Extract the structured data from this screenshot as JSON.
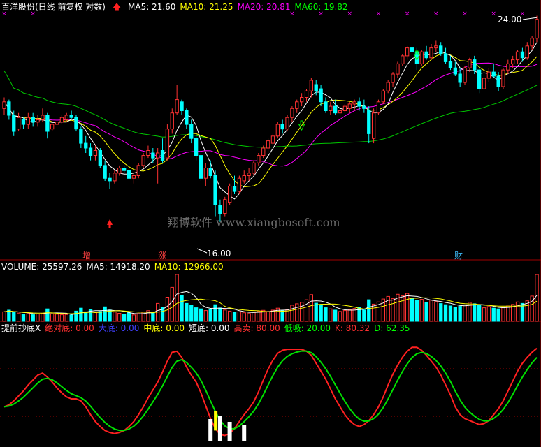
{
  "header": {
    "stock": "百洋股份(日线 前复权 对数)",
    "ma": [
      {
        "label": "MA5: 21.60",
        "color": "#ffffff"
      },
      {
        "label": "MA10: 21.25",
        "color": "#ffff00"
      },
      {
        "label": "MA20: 20.81",
        "color": "#ff00ff"
      },
      {
        "label": "MA60: 19.82",
        "color": "#00ff00"
      }
    ]
  },
  "volume_header": [
    {
      "label": "VOLUME: 25597.26",
      "color": "#ffffff"
    },
    {
      "label": "MA5: 14918.20",
      "color": "#ffffff"
    },
    {
      "label": "MA10: 12966.00",
      "color": "#ffff00"
    }
  ],
  "indicator_header": [
    {
      "label": "提前抄底X",
      "color": "#ffffff"
    },
    {
      "label": "绝对底: 0.00",
      "color": "#ff3030"
    },
    {
      "label": "大底: 0.00",
      "color": "#4040ff"
    },
    {
      "label": "中底: 0.00",
      "color": "#ffff00"
    },
    {
      "label": "短底: 0.00",
      "color": "#ffffff"
    },
    {
      "label": "高卖: 80.00",
      "color": "#ff3030"
    },
    {
      "label": "低吸: 20.00",
      "color": "#00ff00"
    },
    {
      "label": "K: 80.32",
      "color": "#ff3030"
    },
    {
      "label": "D: 62.35",
      "color": "#00ff00"
    }
  ],
  "annotations": {
    "high_price": "24.00",
    "low_price": "16.00",
    "watermark": "翔博软件 www.xiangbosoft.com",
    "marker_zeng": "增",
    "marker_zhang": "涨",
    "marker_cai": "财"
  },
  "colors": {
    "up": "#ff3232",
    "down": "#00ffff",
    "ma5": "#ffffff",
    "ma10": "#ffff00",
    "ma20": "#ff00ff",
    "ma60": "#00c800",
    "k_line": "#ff2020",
    "d_line": "#00e000",
    "grid": "#a00000"
  },
  "chart_data": [
    {
      "type": "candlestick",
      "title": "百洋股份(日线 前复权 对数)",
      "y_scale": "log",
      "ylim": [
        15.0,
        25.2
      ],
      "annotated_high": 24.0,
      "annotated_low": 16.0,
      "ohlc": [
        [
          20.5,
          21.0,
          20.2,
          20.8
        ],
        [
          20.8,
          20.9,
          20.0,
          20.2
        ],
        [
          20.2,
          20.4,
          19.3,
          19.5
        ],
        [
          19.6,
          20.3,
          19.5,
          20.1
        ],
        [
          20.0,
          20.1,
          19.6,
          19.8
        ],
        [
          19.8,
          20.3,
          19.6,
          20.1
        ],
        [
          20.1,
          20.3,
          19.7,
          19.9
        ],
        [
          19.9,
          20.2,
          19.7,
          20.0
        ],
        [
          20.0,
          20.5,
          19.9,
          20.2
        ],
        [
          20.2,
          20.3,
          19.2,
          19.5
        ],
        [
          19.6,
          19.9,
          19.5,
          19.8
        ],
        [
          19.8,
          20.1,
          19.7,
          19.9
        ],
        [
          19.9,
          20.2,
          19.8,
          20.1
        ],
        [
          20.0,
          20.3,
          19.9,
          20.2
        ],
        [
          20.2,
          20.4,
          20.0,
          20.1
        ],
        [
          20.1,
          20.2,
          19.5,
          19.6
        ],
        [
          19.6,
          19.7,
          18.8,
          19.0
        ],
        [
          19.0,
          19.3,
          18.6,
          18.8
        ],
        [
          18.8,
          19.0,
          18.3,
          18.5
        ],
        [
          18.5,
          18.9,
          18.3,
          18.7
        ],
        [
          18.7,
          18.8,
          18.0,
          18.1
        ],
        [
          18.1,
          18.3,
          17.5,
          17.6
        ],
        [
          17.6,
          17.8,
          17.2,
          17.5
        ],
        [
          17.5,
          17.9,
          17.4,
          17.8
        ],
        [
          17.8,
          18.1,
          17.7,
          18.0
        ],
        [
          18.0,
          18.1,
          17.8,
          17.9
        ],
        [
          17.9,
          18.0,
          17.3,
          17.6
        ],
        [
          17.6,
          17.8,
          17.4,
          17.7
        ],
        [
          17.7,
          18.2,
          17.6,
          18.1
        ],
        [
          18.1,
          18.6,
          18.0,
          18.5
        ],
        [
          18.5,
          18.9,
          18.4,
          18.7
        ],
        [
          18.6,
          18.8,
          18.2,
          18.4
        ],
        [
          18.4,
          18.8,
          17.4,
          18.6
        ],
        [
          18.7,
          19.2,
          18.2,
          18.3
        ],
        [
          18.4,
          19.8,
          18.3,
          19.6
        ],
        [
          19.6,
          20.5,
          19.4,
          20.3
        ],
        [
          20.3,
          21.6,
          20.2,
          20.9
        ],
        [
          20.8,
          20.9,
          20.2,
          20.4
        ],
        [
          20.4,
          20.5,
          19.6,
          19.8
        ],
        [
          19.8,
          20.0,
          19.0,
          19.2
        ],
        [
          19.2,
          19.4,
          18.3,
          18.5
        ],
        [
          18.5,
          18.6,
          17.5,
          17.6
        ],
        [
          17.6,
          18.2,
          17.3,
          18.0
        ],
        [
          18.0,
          18.3,
          17.6,
          17.7
        ],
        [
          17.7,
          17.9,
          16.2,
          16.6
        ],
        [
          16.6,
          16.8,
          16.0,
          16.3
        ],
        [
          16.3,
          16.9,
          16.2,
          16.8
        ],
        [
          16.7,
          17.4,
          16.6,
          17.3
        ],
        [
          17.3,
          17.7,
          17.0,
          17.1
        ],
        [
          17.1,
          17.7,
          17.0,
          17.6
        ],
        [
          17.5,
          17.9,
          17.4,
          17.7
        ],
        [
          17.7,
          18.0,
          17.5,
          17.8
        ],
        [
          17.8,
          18.3,
          17.7,
          18.2
        ],
        [
          18.2,
          18.6,
          18.1,
          18.5
        ],
        [
          18.5,
          18.9,
          18.4,
          18.8
        ],
        [
          18.8,
          19.2,
          18.6,
          19.1
        ],
        [
          19.0,
          19.4,
          18.9,
          19.3
        ],
        [
          19.3,
          19.9,
          19.2,
          19.8
        ],
        [
          19.8,
          20.0,
          19.4,
          19.6
        ],
        [
          19.6,
          20.2,
          19.5,
          20.1
        ],
        [
          20.1,
          20.6,
          19.9,
          20.5
        ],
        [
          20.5,
          20.9,
          20.3,
          20.8
        ],
        [
          20.8,
          21.2,
          20.6,
          21.0
        ],
        [
          21.0,
          21.4,
          20.8,
          21.3
        ],
        [
          21.3,
          21.9,
          21.0,
          21.8
        ],
        [
          21.6,
          21.8,
          21.1,
          21.3
        ],
        [
          21.4,
          21.6,
          20.6,
          20.8
        ],
        [
          20.8,
          21.0,
          20.3,
          20.4
        ],
        [
          20.4,
          20.8,
          20.2,
          20.6
        ],
        [
          20.6,
          20.9,
          20.2,
          20.3
        ],
        [
          20.3,
          20.5,
          20.1,
          20.4
        ],
        [
          20.4,
          20.7,
          20.3,
          20.6
        ],
        [
          20.5,
          20.8,
          20.3,
          20.7
        ],
        [
          20.7,
          20.9,
          20.4,
          20.8
        ],
        [
          20.8,
          21.0,
          20.4,
          20.6
        ],
        [
          20.6,
          20.9,
          20.3,
          20.5
        ],
        [
          20.4,
          20.6,
          19.0,
          19.4
        ],
        [
          19.2,
          20.5,
          19.0,
          20.3
        ],
        [
          20.3,
          20.9,
          20.2,
          20.8
        ],
        [
          20.8,
          21.4,
          20.7,
          21.3
        ],
        [
          21.3,
          21.8,
          21.2,
          21.7
        ],
        [
          21.7,
          22.2,
          21.5,
          22.1
        ],
        [
          22.1,
          22.7,
          21.9,
          22.6
        ],
        [
          22.6,
          23.1,
          22.5,
          23.0
        ],
        [
          23.0,
          23.5,
          22.8,
          23.4
        ],
        [
          23.4,
          23.7,
          22.9,
          23.2
        ],
        [
          23.2,
          23.4,
          22.3,
          22.6
        ],
        [
          22.6,
          23.3,
          22.5,
          23.2
        ],
        [
          23.2,
          23.5,
          22.8,
          22.9
        ],
        [
          22.9,
          23.6,
          22.8,
          23.4
        ],
        [
          23.4,
          23.8,
          23.2,
          23.5
        ],
        [
          23.5,
          23.7,
          23.0,
          23.1
        ],
        [
          23.1,
          23.4,
          22.6,
          22.7
        ],
        [
          22.7,
          23.0,
          22.3,
          22.4
        ],
        [
          22.4,
          22.7,
          22.0,
          22.1
        ],
        [
          22.1,
          22.4,
          21.5,
          21.7
        ],
        [
          21.7,
          22.5,
          21.6,
          22.4
        ],
        [
          22.4,
          22.9,
          22.2,
          22.8
        ],
        [
          22.8,
          23.0,
          22.1,
          22.3
        ],
        [
          22.3,
          22.5,
          21.2,
          21.4
        ],
        [
          21.4,
          22.0,
          21.2,
          21.9
        ],
        [
          21.9,
          22.4,
          21.7,
          22.2
        ],
        [
          22.2,
          22.6,
          21.9,
          22.0
        ],
        [
          22.0,
          22.2,
          21.3,
          21.5
        ],
        [
          21.5,
          22.4,
          21.4,
          22.3
        ],
        [
          22.3,
          22.8,
          22.1,
          22.6
        ],
        [
          22.6,
          23.0,
          22.4,
          22.8
        ],
        [
          22.8,
          23.3,
          22.6,
          23.2
        ],
        [
          23.2,
          23.4,
          22.7,
          22.9
        ],
        [
          22.9,
          23.7,
          22.8,
          23.5
        ],
        [
          23.5,
          24.0,
          23.3,
          23.9
        ],
        [
          23.9,
          25.1,
          23.7,
          24.9
        ]
      ]
    },
    {
      "type": "bar",
      "title": "VOLUME",
      "ylim": [
        0,
        26000
      ],
      "values": [
        5200,
        6100,
        4800,
        4500,
        3800,
        4200,
        3600,
        4000,
        4400,
        6800,
        4100,
        3900,
        3600,
        3700,
        3400,
        5600,
        7200,
        5200,
        6400,
        4800,
        5400,
        7900,
        6200,
        5100,
        4400,
        3800,
        4600,
        3500,
        4300,
        5000,
        5800,
        4700,
        9800,
        7600,
        13200,
        18600,
        25600,
        14200,
        9800,
        8600,
        7400,
        6800,
        5900,
        6600,
        9100,
        7300,
        6200,
        5600,
        4800,
        5200,
        4700,
        4300,
        5100,
        5600,
        6000,
        5400,
        6100,
        7200,
        5800,
        6500,
        8800,
        9600,
        10400,
        11800,
        14600,
        9900,
        8700,
        7400,
        6800,
        6100,
        5400,
        5900,
        6300,
        7000,
        7600,
        6200,
        11800,
        9400,
        10600,
        12200,
        13600,
        12400,
        14800,
        13900,
        15200,
        12800,
        11400,
        12000,
        10200,
        11600,
        10800,
        9700,
        9100,
        8400,
        7800,
        8200,
        9000,
        10400,
        9600,
        8800,
        7400,
        8100,
        7200,
        6800,
        7600,
        8400,
        9200,
        10600,
        9800,
        11200,
        13800,
        25597
      ]
    },
    {
      "type": "line",
      "title": "提前抄底X",
      "ylim": [
        -5,
        105
      ],
      "series": [
        {
          "name": "K",
          "color": "#ff2020",
          "values": [
            30,
            32,
            36,
            41,
            46,
            52,
            57,
            62,
            64,
            60,
            55,
            49,
            44,
            40,
            38,
            38,
            36,
            30,
            22,
            15,
            10,
            6,
            4,
            3,
            4,
            6,
            10,
            15,
            22,
            30,
            39,
            47,
            55,
            65,
            76,
            85,
            86,
            80,
            70,
            62,
            55,
            44,
            31,
            18,
            8,
            2,
            1,
            3,
            8,
            15,
            22,
            28,
            35,
            45,
            57,
            68,
            77,
            84,
            87,
            88,
            88,
            88,
            88,
            86,
            82,
            74,
            66,
            58,
            48,
            38,
            30,
            22,
            16,
            12,
            10,
            12,
            16,
            22,
            30,
            40,
            52,
            63,
            72,
            80,
            86,
            90,
            90,
            87,
            82,
            76,
            70,
            62,
            52,
            42,
            30,
            22,
            18,
            16,
            14,
            12,
            13,
            16,
            22,
            28,
            36,
            46,
            56,
            66,
            74,
            80,
            85,
            89,
            91,
            90,
            82,
            72,
            60,
            48,
            38,
            32,
            28,
            25,
            80
          ]
        }
      ],
      "lines": [
        {
          "name": "高卖",
          "value": 80
        },
        {
          "name": "低吸",
          "value": 20
        }
      ],
      "bottom_bars": [
        {
          "index": 43,
          "height": 16
        },
        {
          "index": 45,
          "height": 18
        },
        {
          "index": 47,
          "height": 14
        },
        {
          "index": 50,
          "height": 12
        }
      ]
    }
  ]
}
